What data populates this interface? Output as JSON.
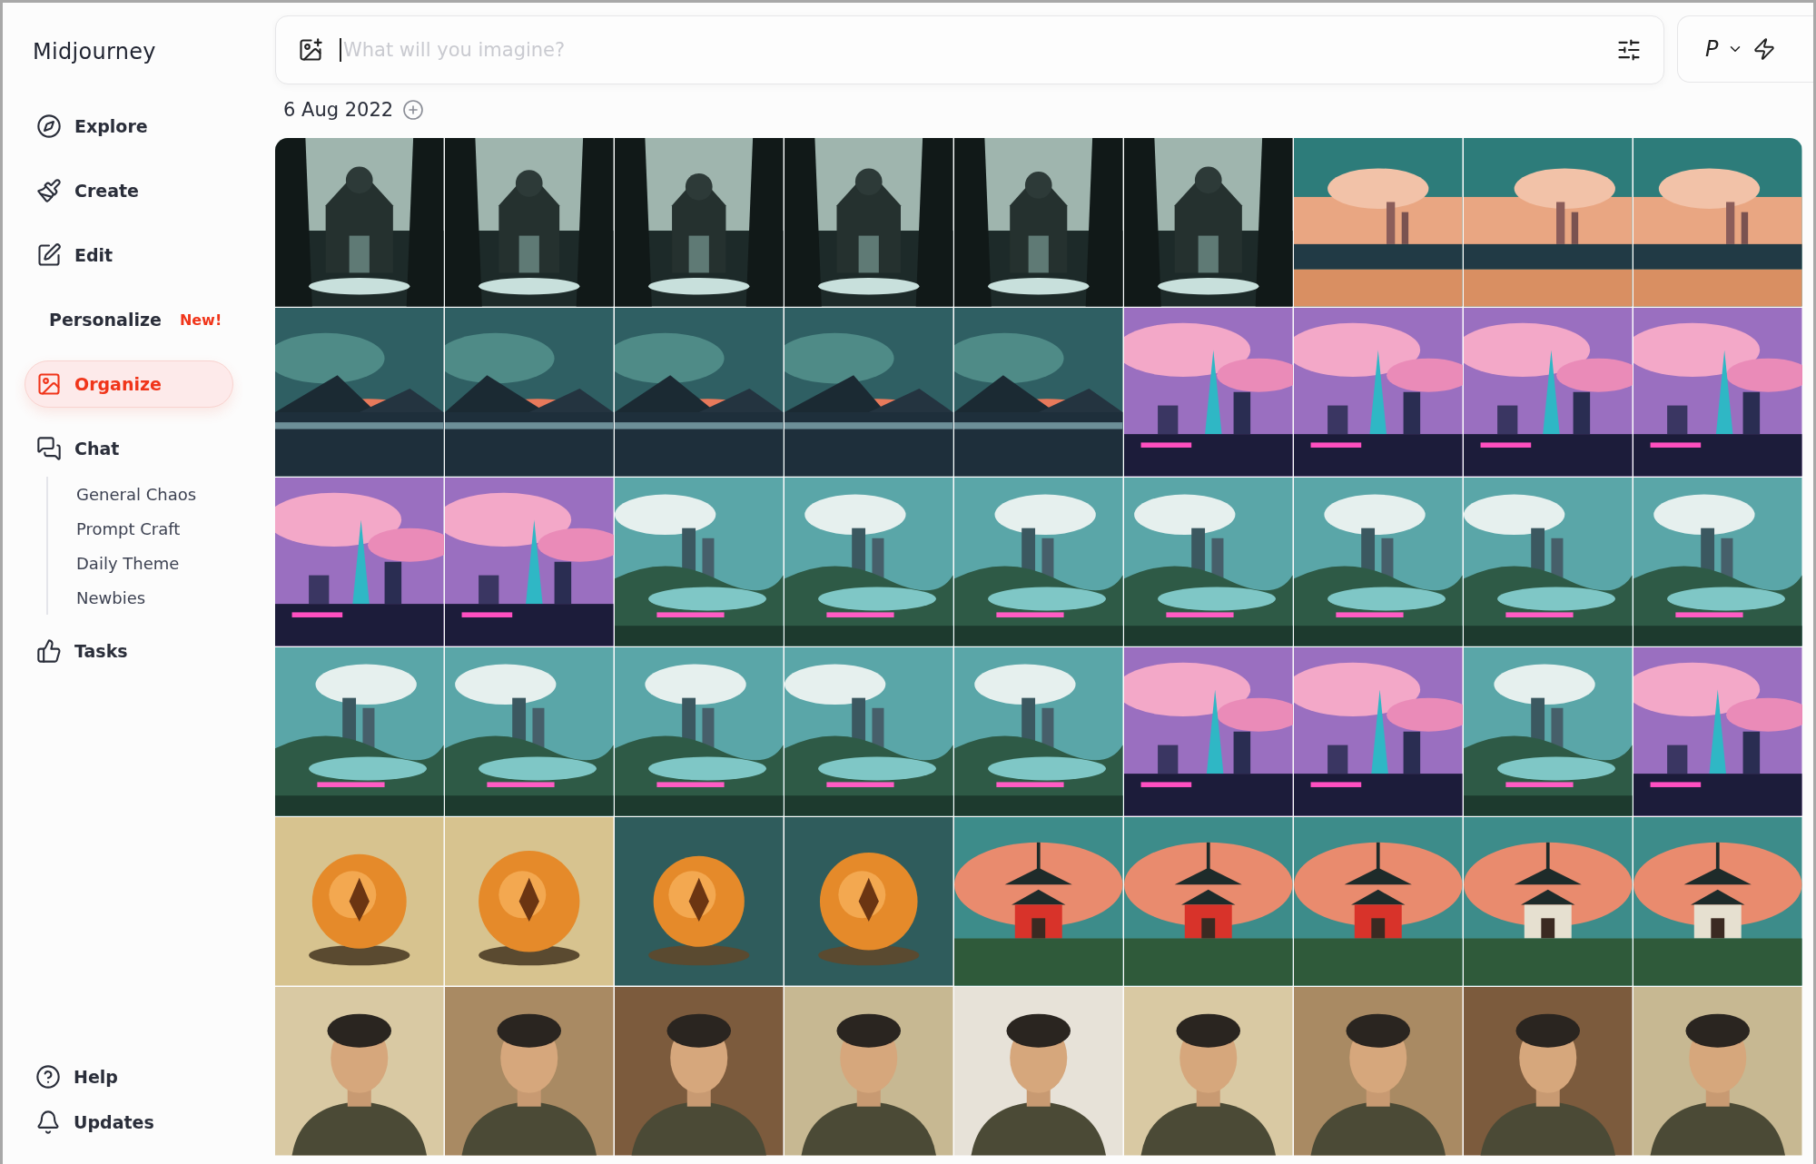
{
  "sidebar": {
    "brand": "Midjourney",
    "items": [
      {
        "label": "Explore",
        "selected": false
      },
      {
        "label": "Create",
        "selected": false
      },
      {
        "label": "Edit",
        "selected": false
      },
      {
        "label": "Personalize",
        "selected": false,
        "badge": "New!"
      },
      {
        "label": "Organize",
        "selected": true
      },
      {
        "label": "Chat",
        "selected": false,
        "children": [
          {
            "label": "General Chaos"
          },
          {
            "label": "Prompt Craft"
          },
          {
            "label": "Daily Theme"
          },
          {
            "label": "Newbies"
          }
        ]
      },
      {
        "label": "Tasks",
        "selected": false
      }
    ],
    "footer": [
      {
        "label": "Help"
      },
      {
        "label": "Updates"
      }
    ]
  },
  "prompt": {
    "placeholder": "What will you imagine?",
    "mode_label": "P"
  },
  "gallery": {
    "date": "6 Aug 2022"
  }
}
